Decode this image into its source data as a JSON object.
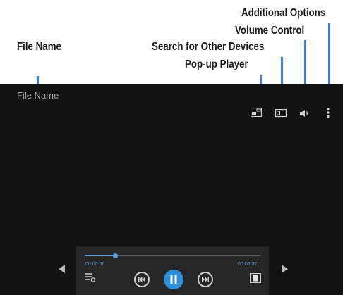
{
  "callouts": {
    "additional_options": "Additional Options",
    "volume_control": "Volume Control",
    "file_name": "File Name",
    "search_devices": "Search for Other Devices",
    "popup_player": "Pop-up Player"
  },
  "player": {
    "file_name": "File Name",
    "elapsed": "00:00:06",
    "total": "00:00:37",
    "progress": 0.17,
    "state": "playing"
  },
  "colors": {
    "leader": "#3b7fd0",
    "accent": "#2f8fd8",
    "screen_bg": "#121212"
  },
  "icons": {
    "popup": "popup-player-icon",
    "search": "search-devices-icon",
    "volume": "volume-icon",
    "more": "more-options-icon",
    "prev": "previous-icon",
    "play_pause": "pause-icon",
    "next": "next-icon",
    "playlist": "playlist-settings-icon",
    "aspect": "screen-ratio-icon"
  }
}
